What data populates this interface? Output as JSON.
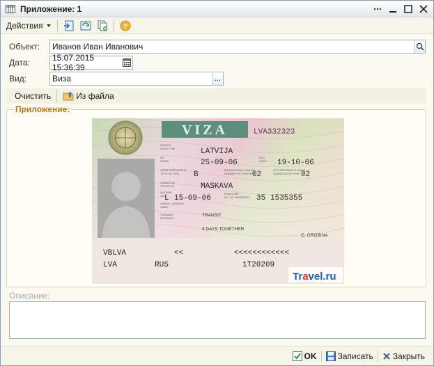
{
  "window": {
    "title": "Приложение: 1"
  },
  "toolbar": {
    "actions_label": "Действия"
  },
  "form": {
    "object_label": "Объект:",
    "object_value": "Иванов Иван Иванович",
    "date_label": "Дата:",
    "date_value": "15.07.2015 15:36:39",
    "kind_label": "Вид:",
    "kind_value": "Виза",
    "kind_button": "..."
  },
  "subtoolbar": {
    "clear_label": "Очистить",
    "from_file_label": "Из файла"
  },
  "attachment": {
    "group_title": "Приложение:",
    "visa": {
      "header": "VIZA",
      "number": "LVA332323",
      "country": "LATVIJA",
      "valid_from": "25-09-06",
      "valid_until": "19-10-06",
      "visa_type": "B",
      "entries": "02",
      "days": "02",
      "issued_in": "MASKAVA",
      "issue_prefix": "L",
      "issue_date": "15-09-06",
      "passport_prefix": "35",
      "passport_no": "1535355",
      "remarks": "TRANSIT",
      "days_together": "4 DAYS TOGETHER",
      "signature": "G. GROBINA",
      "mrz_line1_left": "VBLVA",
      "mrz_line1_mid": "<<",
      "mrz_line1_right": "<<<<<<<<<<<<",
      "mrz_line2_left": "LVA",
      "mrz_line2_mid": "RUS",
      "mrz_line2_right": "1T20209",
      "watermark_brand_a": "Tr",
      "watermark_brand_b": "a",
      "watermark_brand_c": "vel.ru"
    }
  },
  "description": {
    "label": "Описание:",
    "value": ""
  },
  "bottom": {
    "ok_label": "OK",
    "save_label": "Записать",
    "close_label": "Закрыть"
  },
  "colors": {
    "group_title": "#b37b1a",
    "accent_blue": "#2a6fb5"
  }
}
